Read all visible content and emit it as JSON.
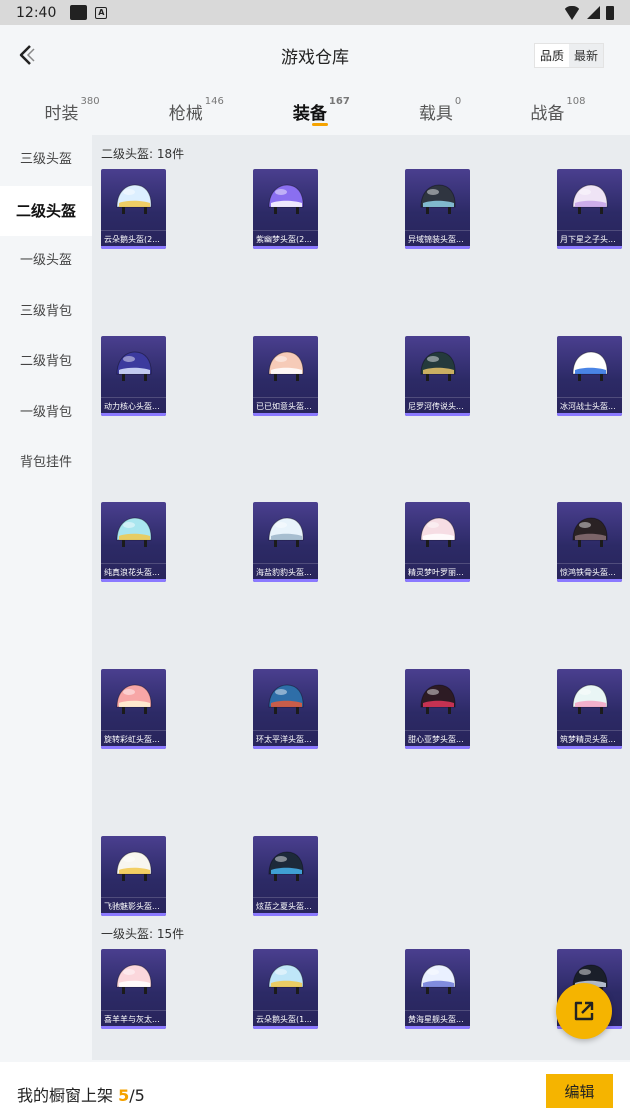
{
  "status": {
    "time": "12:40",
    "app_icon_letter": "A"
  },
  "header": {
    "title": "游戏仓库",
    "sort": [
      "品质",
      "最新"
    ]
  },
  "tabs": [
    {
      "label": "时装",
      "count": "380"
    },
    {
      "label": "枪械",
      "count": "146"
    },
    {
      "label": "装备",
      "count": "167"
    },
    {
      "label": "载具",
      "count": "0"
    },
    {
      "label": "战备",
      "count": "108"
    }
  ],
  "sidebar": [
    "三级头盔",
    "二级头盔",
    "一级头盔",
    "三级背包",
    "二级背包",
    "一级背包",
    "背包挂件"
  ],
  "sections": [
    {
      "title": "二级头盔: 18件"
    },
    {
      "title": "一级头盔: 15件"
    }
  ],
  "items": [
    {
      "name": "云朵鹅头盔(2...",
      "color": "#dcefff",
      "accent": "#f2c84b"
    },
    {
      "name": "紫幽梦头盔(2...",
      "color": "#8a6ff0",
      "accent": "#ffffff"
    },
    {
      "name": "异域锦装头盔...",
      "color": "#2f3540",
      "accent": "#8fd0e8"
    },
    {
      "name": "月下星之子头...",
      "color": "#efe4f6",
      "accent": "#c7a3e8"
    },
    {
      "name": "动力核心头盔...",
      "color": "#3c3a9e",
      "accent": "#d9e4ff"
    },
    {
      "name": "已已如意头盔...",
      "color": "#f6cbb8",
      "accent": "#ffffff"
    },
    {
      "name": "尼罗河传说头...",
      "color": "#243a3c",
      "accent": "#e7c46a"
    },
    {
      "name": "冰河战士头盔...",
      "color": "#ffffff",
      "accent": "#2a6fe0"
    },
    {
      "name": "纯真浪花头盔...",
      "color": "#a9e6ef",
      "accent": "#f2c84b"
    },
    {
      "name": "海盐豹豹头盔...",
      "color": "#e8f3fb",
      "accent": "#9bb4c8"
    },
    {
      "name": "精灵梦叶罗丽...",
      "color": "#f6dde4",
      "accent": "#ffffff"
    },
    {
      "name": "惊鸿铁骨头盔...",
      "color": "#2a2224",
      "accent": "#8a7074"
    },
    {
      "name": "旋转彩虹头盔...",
      "color": "#f7a6a6",
      "accent": "#fff3d6"
    },
    {
      "name": "环太平洋头盔...",
      "color": "#2e6ea8",
      "accent": "#e35b3a"
    },
    {
      "name": "甜心亚梦头盔...",
      "color": "#2d1b24",
      "accent": "#e0365a"
    },
    {
      "name": "筑梦精灵头盔...",
      "color": "#e9f6f5",
      "accent": "#f3a4c4"
    },
    {
      "name": "飞驰魅影头盔...",
      "color": "#f8f6ef",
      "accent": "#f2c84b"
    },
    {
      "name": "炫蓝之夏头盔...",
      "color": "#1d2a3a",
      "accent": "#47b4f0"
    },
    {
      "name": "喜羊羊与灰太...",
      "color": "#fbd7dc",
      "accent": "#ffffff"
    },
    {
      "name": "云朵鹅头盔(1...",
      "color": "#bfe6f8",
      "accent": "#f2c84b"
    },
    {
      "name": "黄海星舰头盔...",
      "color": "#eaf0ff",
      "accent": "#6f7ad8"
    },
    {
      "name": "",
      "color": "#1a1f2a",
      "accent": "#cfd8e8"
    }
  ],
  "bottom": {
    "label": "我的橱窗上架 ",
    "current": "5",
    "slash": "/",
    "total": "5",
    "edit_label": "编辑"
  },
  "colors": {
    "accent": "#f5b400",
    "tab_underline": "#f5a300",
    "card_bg": "#2c2a66"
  },
  "icons": {
    "back": "chevron-left-icon",
    "share": "external-link-icon"
  }
}
